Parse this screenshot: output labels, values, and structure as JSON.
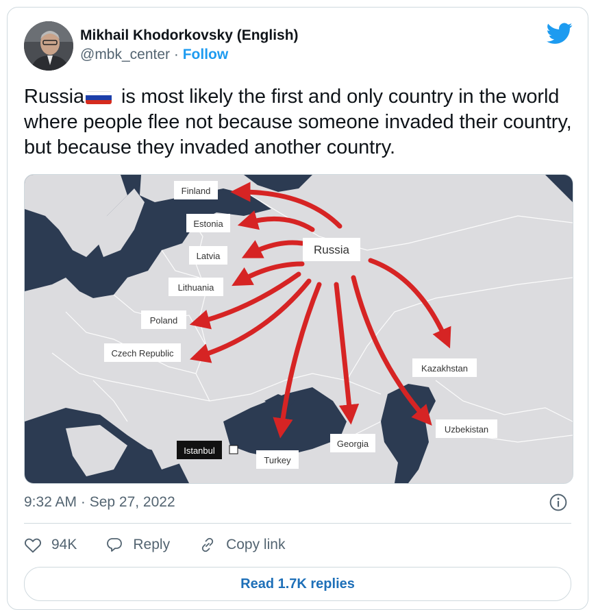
{
  "author": {
    "name": "Mikhail Khodorkovsky (English)",
    "handle": "@mbk_center",
    "separator": "·",
    "follow_label": "Follow"
  },
  "tweet": {
    "text_part1": "Russia",
    "text_part2": " is most likely the first and only country in the world where people flee not because someone invaded their country, but because they invaded another country."
  },
  "map": {
    "origin": "Russia",
    "destinations": [
      "Finland",
      "Estonia",
      "Latvia",
      "Lithuania",
      "Poland",
      "Czech Republic",
      "Kazakhstan",
      "Georgia",
      "Turkey",
      "Uzbekistan"
    ],
    "city_label": "Istanbul",
    "arrow_color": "#d62424",
    "land_color": "#d9dadc",
    "water_color": "#2c3b52"
  },
  "meta": {
    "timestamp": "9:32 AM · Sep 27, 2022"
  },
  "actions": {
    "likes": "94K",
    "reply_label": "Reply",
    "copy_label": "Copy link"
  },
  "read_replies_label": "Read 1.7K replies",
  "colors": {
    "accent": "#1d9bf0",
    "secondary_text": "#536471",
    "border": "#cfd9de"
  }
}
